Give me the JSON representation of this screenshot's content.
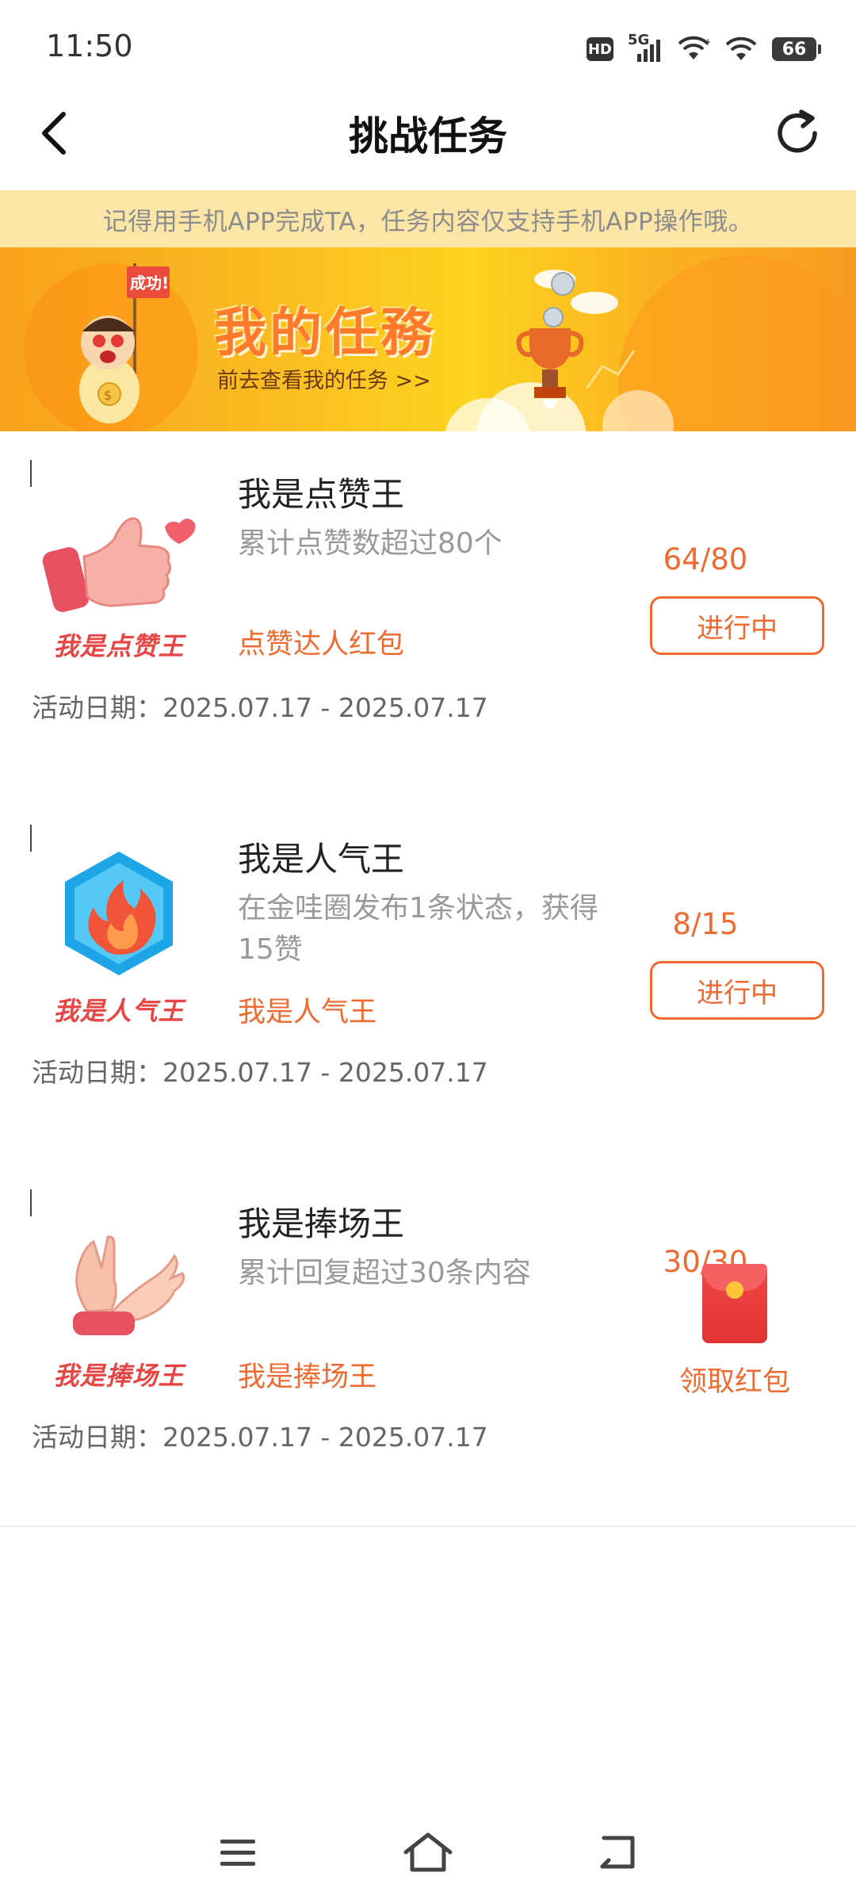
{
  "status_bar": {
    "time": "11:50",
    "hd": "HD",
    "network": "5G",
    "battery": "66"
  },
  "header": {
    "title": "挑战任务",
    "back_icon": "chevron-left-icon",
    "refresh_icon": "refresh-icon"
  },
  "notice": "记得用手机APP完成TA，任务内容仅支持手机APP操作哦。",
  "banner": {
    "flag_text": "成功!",
    "title": "我的任務",
    "subtitle": "前去查看我的任务 >>"
  },
  "tasks": [
    {
      "art_label": "我是点赞王",
      "name": "我是点赞王",
      "description": "累计点赞数超过80个",
      "reward": "点赞达人红包",
      "progress": "64/80",
      "action": "进行中",
      "date": "活动日期：2025.07.17 - 2025.07.17"
    },
    {
      "art_label": "我是人气王",
      "name": "我是人气王",
      "description": "在金哇圈发布1条状态，获得15赞",
      "reward": "我是人气王",
      "progress": "8/15",
      "action": "进行中",
      "date": "活动日期：2025.07.17 - 2025.07.17"
    },
    {
      "art_label": "我是捧场王",
      "name": "我是捧场王",
      "description": "累计回复超过30条内容",
      "reward": "我是捧场王",
      "progress": "30/30",
      "action": "领取红包",
      "date": "活动日期：2025.07.17 - 2025.07.17"
    }
  ],
  "colors": {
    "accent": "#ee6a30",
    "notice_bg": "#fbe6a8",
    "banner": "#fbbf22"
  }
}
